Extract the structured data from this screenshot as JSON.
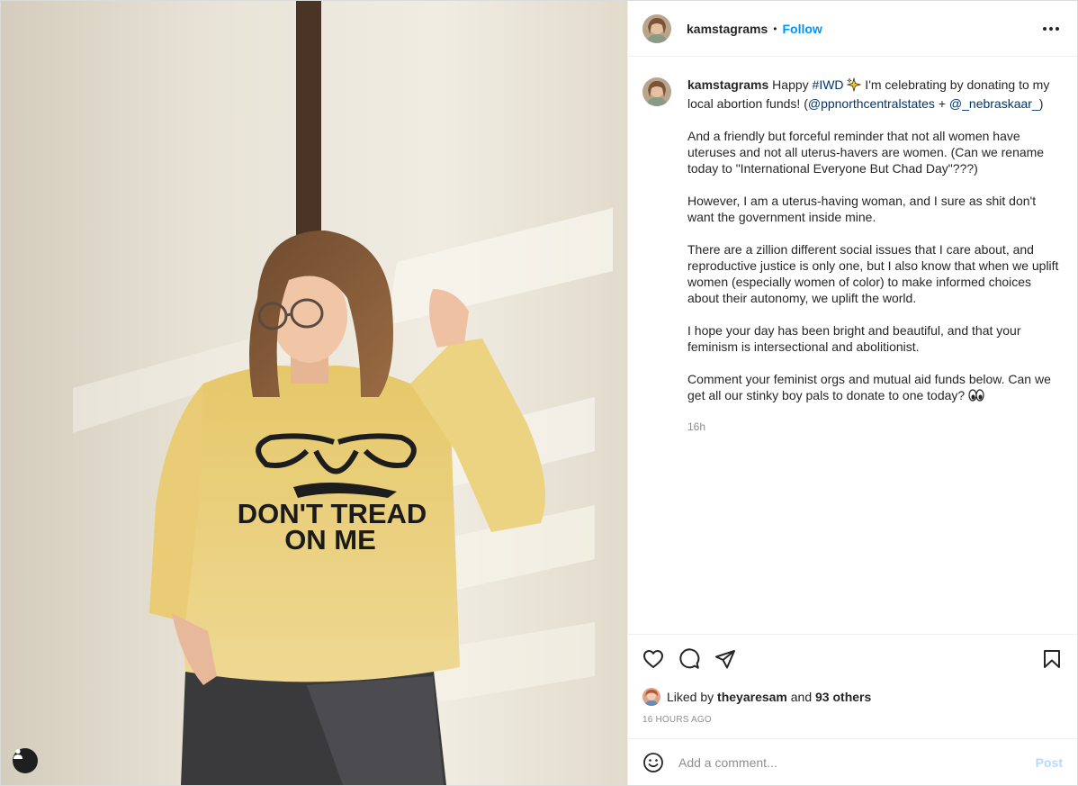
{
  "post": {
    "username": "kamstagrams",
    "follow_label": "Follow",
    "separator": "•",
    "caption": {
      "username": "kamstagrams",
      "line1_pre": "Happy ",
      "hashtag": "#IWD",
      "line1_post": " I'm celebrating by donating to my local abortion funds! (",
      "mention1": "@ppnorthcentralstates",
      "plus": " + ",
      "mention2": "@_nebraskaar_",
      "close": ")",
      "p2": "And a friendly but forceful reminder that not all women have uteruses and not all uterus-havers are women. (Can we rename today to \"International Everyone But Chad Day\"???)",
      "p3": "However, I am a uterus-having woman, and I sure as shit don't want the government inside mine.",
      "p4": "There are a zillion different social issues that I care about, and reproductive justice is only one, but I also know that when we uplift women (especially women of color) to make informed choices about their autonomy, we uplift the world.",
      "p5": "I hope your day has been bright and beautiful, and that your feminism is intersectional and abolitionist.",
      "p6": "Comment your feminist orgs and mutual aid funds below. Can we get all our stinky boy pals to donate to one today?",
      "time": "16h"
    },
    "photo": {
      "shirt_line1": "DON'T TREAD",
      "shirt_line2": "ON ME"
    },
    "likes": {
      "prefix": "Liked by ",
      "user": "theyaresam",
      "middle": " and ",
      "others": "93 others"
    },
    "timestamp": "16 HOURS AGO",
    "comment": {
      "placeholder": "Add a comment...",
      "post_label": "Post"
    }
  },
  "icons": [
    "more-icon",
    "heart-icon",
    "comment-icon",
    "share-icon",
    "bookmark-icon",
    "emoji-icon",
    "user-tag-icon",
    "sparkles-emoji",
    "eyes-emoji"
  ],
  "colors": {
    "accent": "#0095f6",
    "link": "#00376b",
    "muted": "#8e8e8e",
    "post_disabled": "#b3dbff"
  }
}
